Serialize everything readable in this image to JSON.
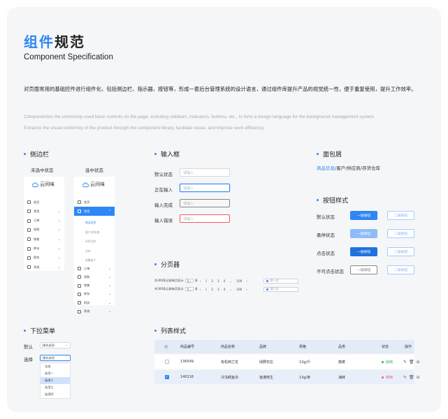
{
  "header": {
    "title_highlight": "组件",
    "title_rest": "规范",
    "subtitle": "Component Specification",
    "desc_cn": "对页面常用的基础控件进行组件化，包括侧边栏、指示器、按钮等，形成一套后台管理系统的设计语言，通过组件库提升产品的视觉统一性，便于重复使用，提升工作效率。",
    "desc_en_1": "Componentize the commonly used basic controls on the page, including sidebars, indicators, buttons, etc., to form a design language for the background management system.",
    "desc_en_2": "Enhance the visual uniformity of the product through the component library, facilitate reuse, and improve work efficiency."
  },
  "colors": {
    "accent": "#2f86f5",
    "error": "#f15b5b",
    "success": "#2bb04a",
    "background": "#f5f6f8"
  },
  "sidebar_section": {
    "title": "侧边栏",
    "unselected_label": "未选中状态",
    "selected_label": "选中状态",
    "logo_text": "云间味",
    "logo_icon": "cloud-icon",
    "items_unselected": [
      "首页",
      "常用",
      "订单",
      "采购",
      "销售",
      "库存",
      "财务",
      "系统"
    ],
    "items_selected_top": [
      "首页",
      "常用"
    ],
    "sub_items": [
      "商品信息",
      "客户/供应商",
      "存货仓库",
      "仓库",
      "结算账户"
    ],
    "items_selected_bottom": [
      "订单",
      "采购",
      "销售",
      "库存",
      "财务",
      "系统"
    ]
  },
  "input_section": {
    "title": "输入框",
    "rows": [
      {
        "label": "默认状态",
        "placeholder": "请输入"
      },
      {
        "label": "正在输入",
        "placeholder": "请输入"
      },
      {
        "label": "输入完成",
        "placeholder": "请输入"
      },
      {
        "label": "输入错误",
        "placeholder": "请输入"
      }
    ]
  },
  "breadcrumb_section": {
    "title": "面包屑",
    "current": "商品信息",
    "rest": "/客户/供应商/存货仓库"
  },
  "button_section": {
    "title": "按钮样式",
    "rows": [
      {
        "label": "默认状态",
        "primary": "一级按钮",
        "secondary": "二级按钮"
      },
      {
        "label": "悬停状态",
        "primary": "一级按钮",
        "secondary": "二级按钮"
      },
      {
        "label": "点击状态",
        "primary": "一级按钮",
        "secondary": "二级按钮"
      },
      {
        "label": "不可点击状态",
        "primary": "一级按钮",
        "secondary": "二级按钮"
      }
    ]
  },
  "pagination_section": {
    "title": "分页器",
    "rows": [
      {
        "total": "共300条记录",
        "per_page_label": "每页显示",
        "per_page": "5",
        "unit": "条",
        "pages": [
          "1",
          "2",
          "3",
          "4"
        ],
        "ellipsis": "...",
        "last": "100",
        "goto": "第一页"
      },
      {
        "total": "共300条记录",
        "per_page_label": "每页显示",
        "per_page": "5",
        "unit": "条",
        "pages": [
          "1",
          "2",
          "3",
          "4"
        ],
        "ellipsis": "...",
        "last": "100",
        "goto": "第六页"
      }
    ]
  },
  "dropdown_section": {
    "title": "下拉菜单",
    "default_label": "默认",
    "select_label": "选择",
    "default_value": "操作选项",
    "select_value": "操作选项",
    "options": [
      "全部",
      "选项一",
      "选项二",
      "选项三",
      "选项四"
    ],
    "selected_index": 2
  },
  "table_section": {
    "title": "列表样式",
    "columns": [
      "商品编号",
      "商品名称",
      "品牌",
      "规格",
      "品类",
      "状态",
      "操作"
    ],
    "rows": [
      {
        "id": "136549",
        "name": "有机西兰花",
        "brand": "绿野农庄",
        "spec": "13g/斤",
        "category": "蔬菜",
        "status": "启用",
        "checked": false
      },
      {
        "id": "140216",
        "name": "冷冻鳕鱼块",
        "brand": "渔港鲜生",
        "spec": "13g/条",
        "category": "海鲜",
        "status": "停用",
        "checked": true
      }
    ],
    "op_icons": [
      "edit-icon",
      "delete-icon",
      "more-icon"
    ]
  }
}
